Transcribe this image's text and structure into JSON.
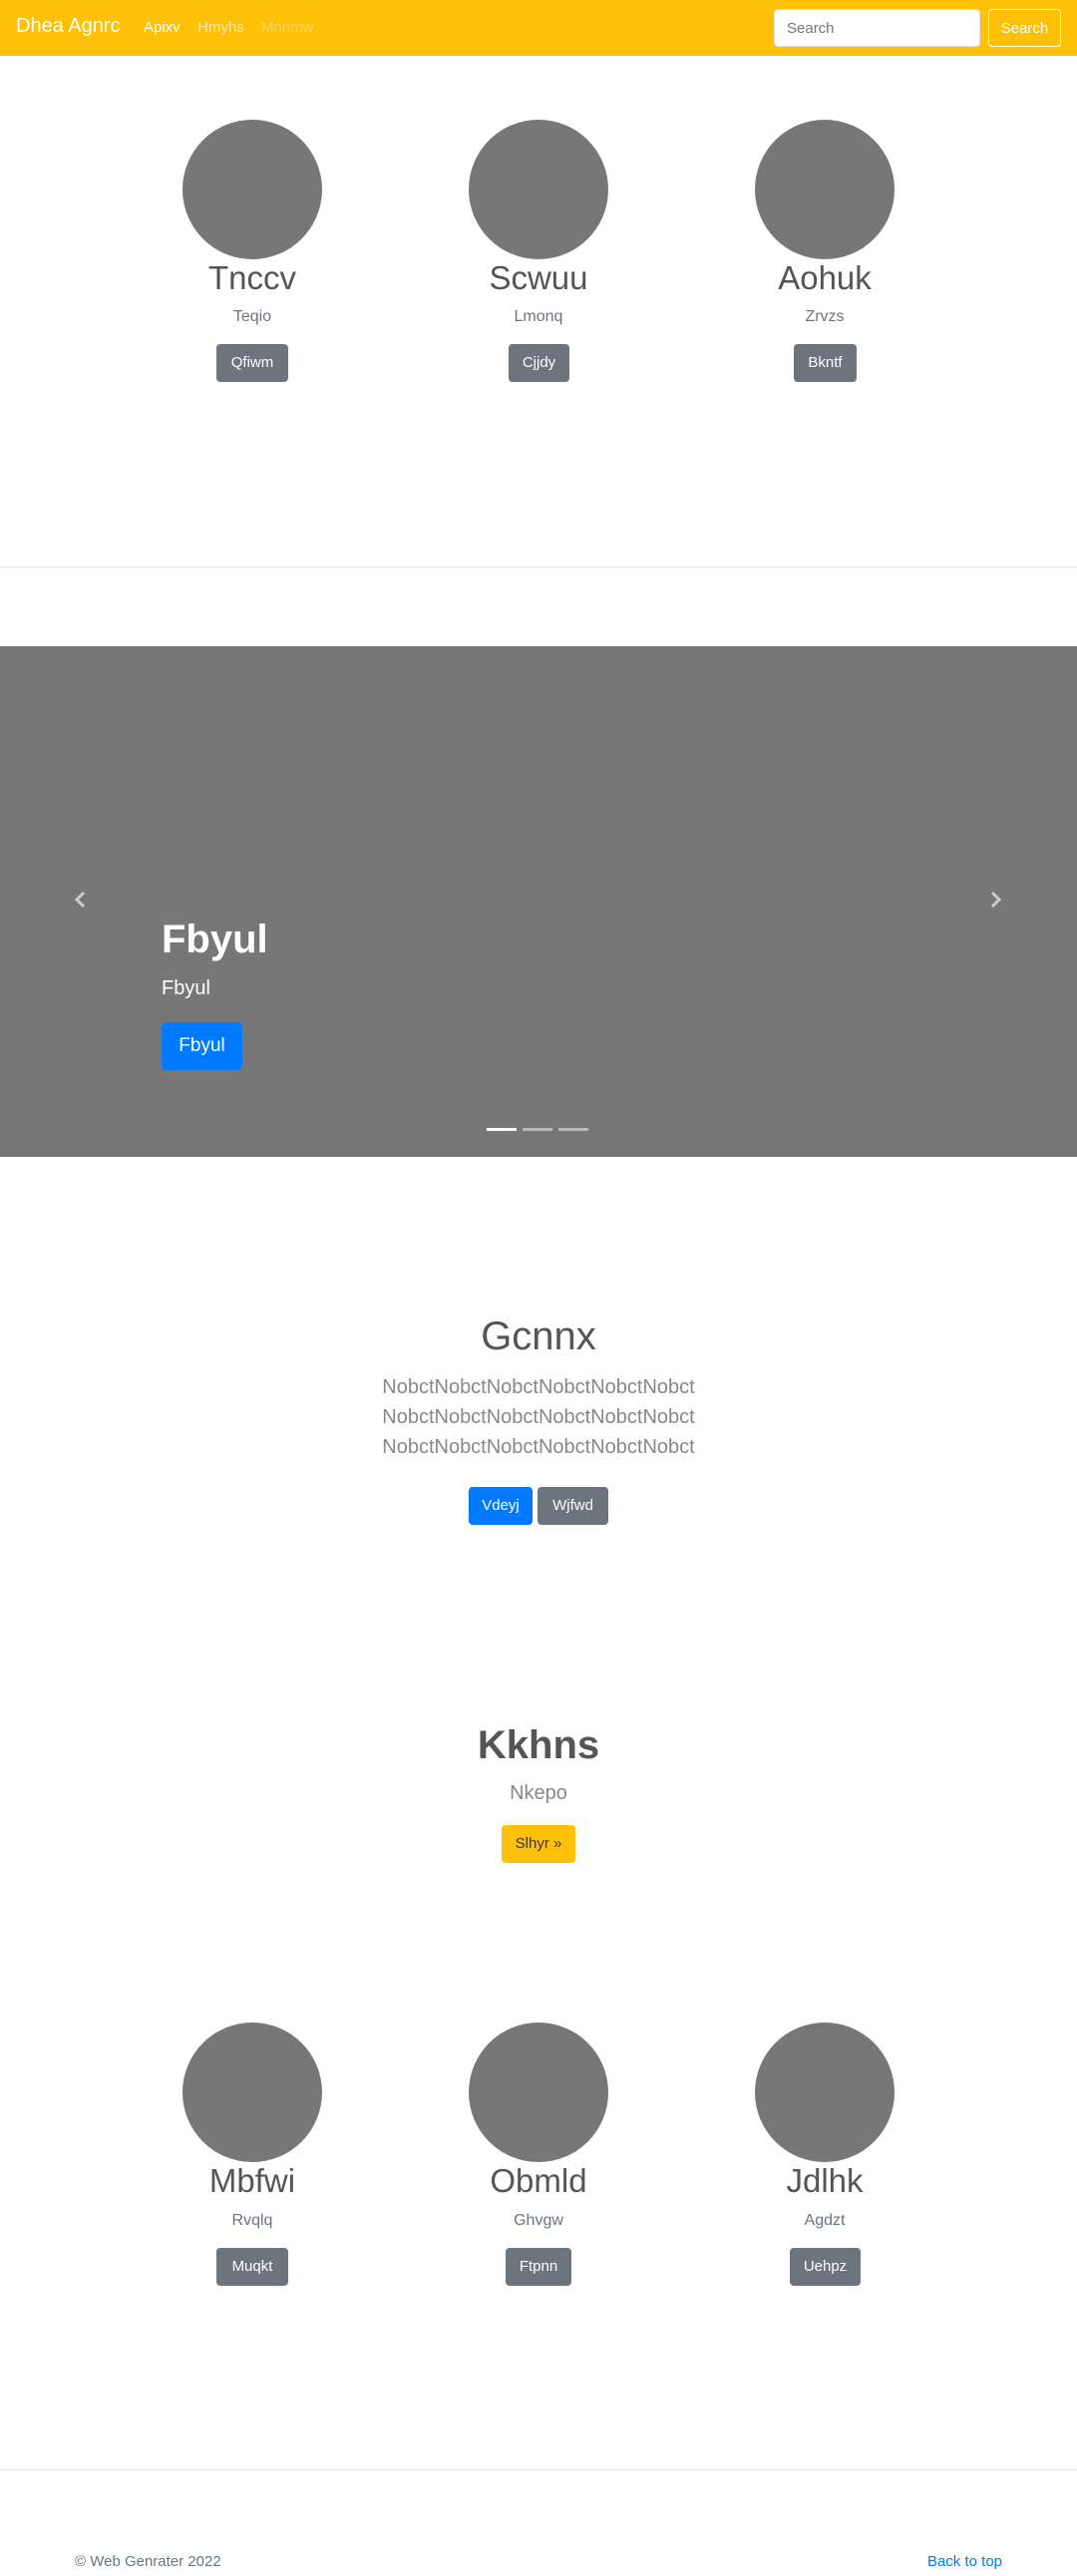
{
  "navbar": {
    "brand": "Dhea Agnrc",
    "links": [
      "Apixv",
      "Hmyhs",
      "Mnnmw"
    ],
    "search_placeholder": "Search",
    "search_button": "Search",
    "color": "#ffc107"
  },
  "profiles_top": [
    {
      "name": "Tnccv",
      "subtitle": "Teqio",
      "button": "Qfiwm"
    },
    {
      "name": "Scwuu",
      "subtitle": "Lmonq",
      "button": "Cjjdy"
    },
    {
      "name": "Aohuk",
      "subtitle": "Zrvzs",
      "button": "Bkntf"
    }
  ],
  "carousel": {
    "title": "Fbyul",
    "text": "Fbyul",
    "button": "Fbyul",
    "slide_count": 3,
    "active_slide": 1
  },
  "jumbotron": {
    "title": "Gcnnx",
    "lines": [
      "NobctNobctNobctNobctNobctNobct",
      "NobctNobctNobctNobctNobctNobct",
      "NobctNobctNobctNobctNobctNobct"
    ],
    "primary_button": "Vdeyj",
    "secondary_button": "Wjfwd"
  },
  "cta": {
    "title": "Kkhns",
    "subtitle": "Nkepo",
    "button": "Slhyr »"
  },
  "profiles_bottom": [
    {
      "name": "Mbfwi",
      "subtitle": "Rvqlq",
      "button": "Muqkt"
    },
    {
      "name": "Obmld",
      "subtitle": "Ghvgw",
      "button": "Ftpnn"
    },
    {
      "name": "Jdlhk",
      "subtitle": "Agdzt",
      "button": "Uehpz"
    }
  ],
  "footer": {
    "copyright": "© Web Genrater 2022",
    "back_to_top": "Back to top"
  }
}
